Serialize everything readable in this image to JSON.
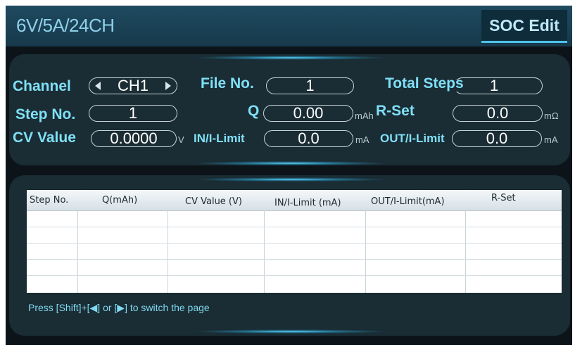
{
  "header": {
    "device": "6V/5A/24CH",
    "mode_tab": "SOC Edit"
  },
  "params": {
    "channel": {
      "label": "Channel",
      "value": "CH1"
    },
    "file_no": {
      "label": "File No.",
      "value": "1"
    },
    "total_steps": {
      "label": "Total Steps",
      "value": "1"
    },
    "step_no": {
      "label": "Step No.",
      "value": "1"
    },
    "q": {
      "label": "Q",
      "value": "0.00",
      "unit": "mAh"
    },
    "r_set": {
      "label": "R-Set",
      "value": "0.0",
      "unit": "mΩ"
    },
    "cv_value": {
      "label": "CV Value",
      "value": "0.0000",
      "unit": "V"
    },
    "in_limit": {
      "label": "IN/I-Limit",
      "value": "0.0",
      "unit": "mA"
    },
    "out_limit": {
      "label": "OUT/I-Limit",
      "value": "0.0",
      "unit": "mA"
    }
  },
  "table": {
    "columns": [
      "Step No.",
      "Q(mAh)",
      "CV Value (V)",
      "IN/I-Limit (mA)",
      "OUT/I-Limit(mA)",
      "R-Set"
    ],
    "rows": []
  },
  "footer": {
    "hint": "Press [Shift]+[◀] or [▶] to switch the page"
  },
  "colors": {
    "background": "#0c1419",
    "label": "#7fe0f6",
    "accent": "#4ec3ea"
  }
}
